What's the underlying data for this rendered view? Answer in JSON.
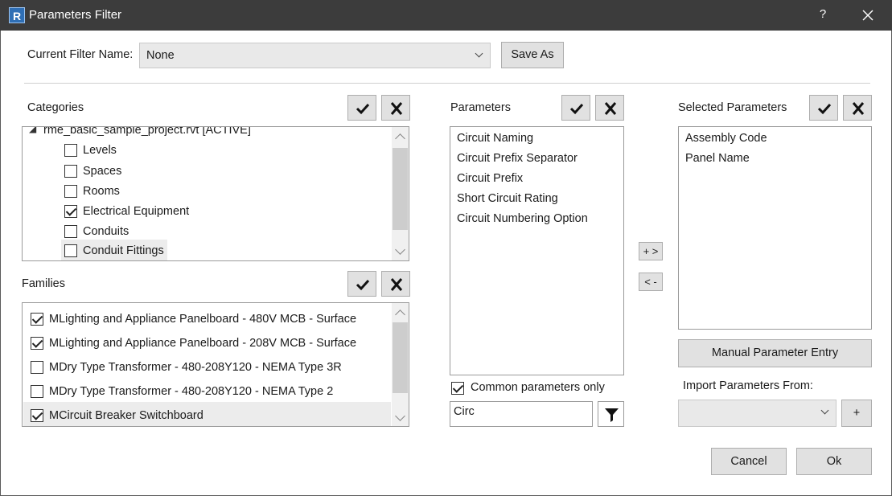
{
  "window": {
    "title": "Parameters Filter",
    "app_icon_letter": "R",
    "help_label": "?"
  },
  "filter": {
    "label": "Current Filter Name:",
    "value": "None",
    "save_as_label": "Save As"
  },
  "categories": {
    "heading": "Categories",
    "root": "rme_basic_sample_project.rvt [ACTIVE]",
    "items": [
      {
        "label": "Levels",
        "checked": false
      },
      {
        "label": "Spaces",
        "checked": false
      },
      {
        "label": "Rooms",
        "checked": false
      },
      {
        "label": "Electrical Equipment",
        "checked": true
      },
      {
        "label": "Conduits",
        "checked": false
      },
      {
        "label": "Conduit Fittings",
        "checked": false
      }
    ]
  },
  "families": {
    "heading": "Families",
    "items": [
      {
        "label": "MLighting and Appliance Panelboard - 480V MCB - Surface",
        "checked": true
      },
      {
        "label": "MLighting and Appliance Panelboard - 208V MCB - Surface",
        "checked": true
      },
      {
        "label": "MDry Type Transformer - 480-208Y120 - NEMA Type 3R",
        "checked": false
      },
      {
        "label": "MDry Type Transformer - 480-208Y120 - NEMA Type 2",
        "checked": false
      },
      {
        "label": "MCircuit Breaker Switchboard",
        "checked": true
      }
    ]
  },
  "parameters": {
    "heading": "Parameters",
    "items": [
      "Circuit Naming",
      "Circuit Prefix Separator",
      "Circuit Prefix",
      "Short Circuit Rating",
      "Circuit Numbering Option"
    ],
    "common_only_label": "Common parameters only",
    "common_only_checked": true,
    "search_value": "Circ"
  },
  "transfer": {
    "add_label": "+ >",
    "remove_label": "< -"
  },
  "selected": {
    "heading": "Selected Parameters",
    "items": [
      "Assembly Code",
      "Panel Name"
    ],
    "manual_entry_label": "Manual Parameter Entry",
    "import_label": "Import Parameters From:",
    "import_value": "",
    "import_add_label": "+"
  },
  "footer": {
    "cancel_label": "Cancel",
    "ok_label": "Ok"
  }
}
